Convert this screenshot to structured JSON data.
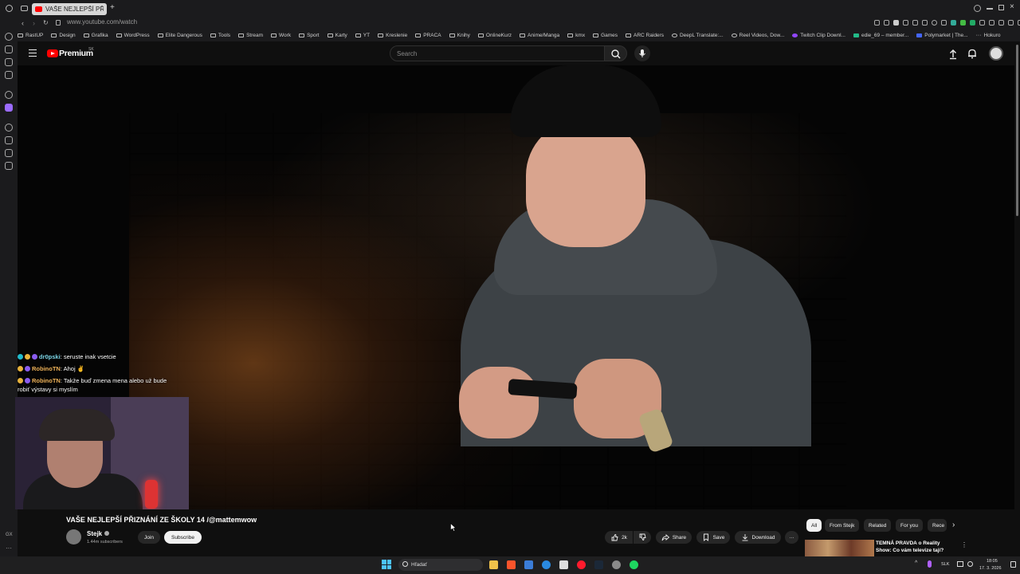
{
  "browser": {
    "tab_title": "VAŠE NEJLEPŠÍ PŘIZNÁNÍ",
    "url": "www.youtube.com/watch",
    "bookmarks": [
      "RastUP",
      "Design",
      "Grafika",
      "WordPress",
      "Elite Dangerous",
      "Tools",
      "Stream",
      "Work",
      "Sport",
      "Karty",
      "YT",
      "Kreslenie",
      "PRACA",
      "Knihy",
      "OnlineKurz",
      "Anime/Manga",
      "kmx",
      "Games",
      "ARC Raiders",
      "DeepL Translate:...",
      "Reel Videos, Dow...",
      "Twitch Clip Downl...",
      "edie_69 – member...",
      "Polymarket | The...",
      "Hokuro"
    ]
  },
  "youtube": {
    "logo_text": "Premium",
    "region": "SK",
    "search_placeholder": "Search"
  },
  "chat": [
    {
      "user": "dr0pski",
      "text": "seruste inak vsetcie"
    },
    {
      "user": "RobinoTN",
      "text": "Ahoj ✌"
    },
    {
      "user": "RobinoTN",
      "text": "Takže buď zmena mena alebo už bude",
      "text2": "robiť výstavy si myslím"
    }
  ],
  "video": {
    "title": "VAŠE NEJLEPŠÍ PŘIZNÁNÍ ZE ŠKOLY 14 /@mattemwow",
    "channel": "Stejk",
    "subscribers": "1.44m subscribers",
    "join_label": "Join",
    "subscribe_label": "Subscribe",
    "likes": "2k",
    "share_label": "Share",
    "save_label": "Save",
    "download_label": "Download"
  },
  "chips": [
    "All",
    "From Stejk",
    "Related",
    "For you",
    "Rece"
  ],
  "suggestion": {
    "title": "TEMNÁ PRAVDA o Reality Show: Co vám televize tají?"
  },
  "taskbar": {
    "search_text": "Hľadať",
    "lang": "SLK",
    "time": "18:05",
    "date": "17. 3. 2026"
  }
}
